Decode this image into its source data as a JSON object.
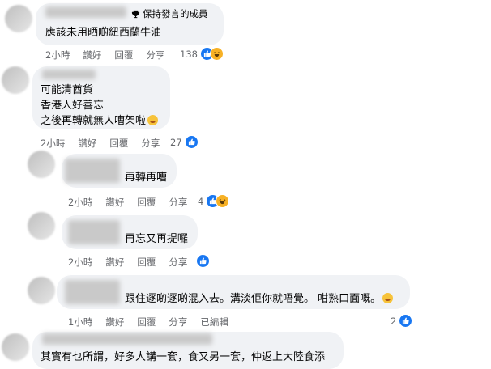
{
  "comments": [
    {
      "badge": "保持發言的成員",
      "lines": [
        "應該未用晒啲紐西蘭牛油"
      ],
      "time": "2小時",
      "like": "讚好",
      "reply": "回覆",
      "share": "分享",
      "count": "138"
    },
    {
      "lines": [
        "可能清酋貨",
        "香港人好善忘",
        "之後再轉就無人嘈架啦"
      ],
      "time": "2小時",
      "like": "讚好",
      "reply": "回覆",
      "share": "分享",
      "count": "27"
    },
    {
      "lines": [
        "再轉再嘈"
      ],
      "time": "2小時",
      "like": "讚好",
      "reply": "回覆",
      "share": "分享",
      "count": "4"
    },
    {
      "lines": [
        "再忘又再提囉"
      ],
      "time": "2小時",
      "like": "讚好",
      "reply": "回覆",
      "share": "分享",
      "count": ""
    },
    {
      "lines": [
        "跟住逐啲逐啲混入去。溝淡佢你就唔覺。 咁熟口面嘅。"
      ],
      "time": "1小時",
      "like": "讚好",
      "reply": "回覆",
      "share": "分享",
      "edited": "已編輯",
      "count": "2"
    },
    {
      "lines": [
        "其實有乜所謂，好多人講一套，食又另一套，仲返上大陸食添"
      ]
    }
  ],
  "icons": {
    "badge": "trophy-icon",
    "like": "like-icon",
    "haha": "haha-icon",
    "emoji": "smile-emoji-icon"
  },
  "colors": {
    "bubble": "#f0f2f5",
    "meta": "#65676b",
    "like": "#1877f2",
    "haha": "#f7b125"
  }
}
